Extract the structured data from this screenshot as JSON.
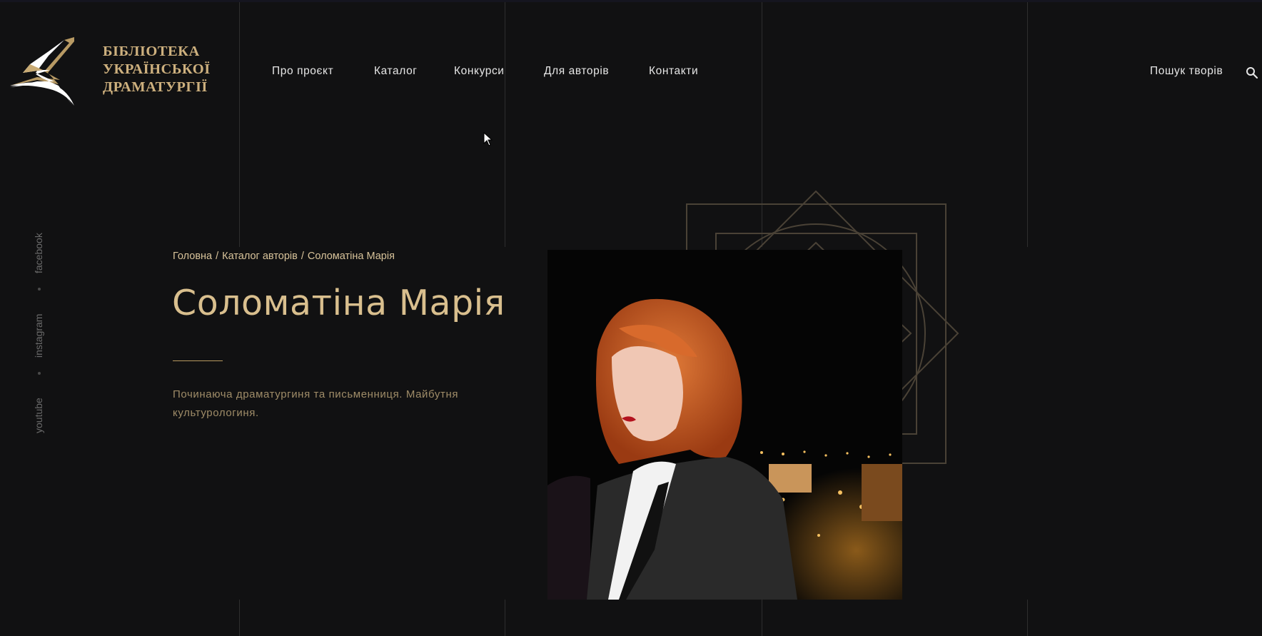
{
  "logo": {
    "lines": [
      "БІБЛІОТЕКА",
      "УКРАЇНСЬКОЇ",
      "ДРАМАТУРГІЇ"
    ],
    "brand_color": "#cdb07e"
  },
  "nav": {
    "items": [
      {
        "label": "Про проєкт"
      },
      {
        "label": "Каталог"
      },
      {
        "label": "Конкурси"
      },
      {
        "label": "Для авторів"
      },
      {
        "label": "Контакти"
      }
    ],
    "search_label": "Пошук творів"
  },
  "social": {
    "facebook": "facebook",
    "instagram": "instagram",
    "youtube": "youtube"
  },
  "breadcrumb": {
    "home": "Головна",
    "catalog": "Каталог авторів",
    "current": "Соломатіна Марія",
    "separator": "/"
  },
  "author": {
    "name": "Соломатіна Марія",
    "bio": "Починаюча драматургиня та письменниця. Майбутня культурологиня."
  },
  "icons": {
    "search": "search-icon",
    "logo": "logo-mark-icon",
    "cursor": "cursor-icon"
  },
  "colors": {
    "background": "#111112",
    "accent": "#d9bf8e",
    "nav_text": "#e6e6e6"
  }
}
